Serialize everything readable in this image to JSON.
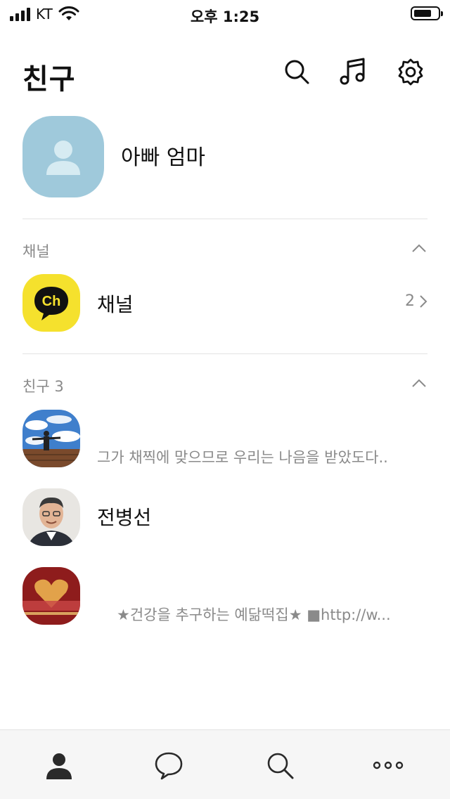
{
  "status_bar": {
    "carrier": "KT",
    "time": "오후 1:25"
  },
  "header": {
    "title": "친구",
    "icons": [
      "search-icon",
      "music-icon",
      "gear-icon"
    ]
  },
  "profile": {
    "name": "아빠 엄마"
  },
  "channel_section": {
    "label": "채널",
    "item": {
      "title": "채널",
      "count": "2",
      "badge_text": "Ch"
    }
  },
  "friends_section": {
    "label": "친구 3",
    "friends": [
      {
        "name": "",
        "status": "그가 채찍에 맞으므로 우리는 나음을 받았도다.."
      },
      {
        "name": "전병선",
        "status": ""
      },
      {
        "name": "",
        "status": "★건강을 추구하는 예닮떡집★ ■http://w..."
      }
    ]
  },
  "bottom_nav": {
    "items": [
      "friends-tab-icon",
      "chats-tab-icon",
      "search-tab-icon",
      "more-tab-icon"
    ]
  },
  "colors": {
    "accent_yellow": "#f5e12d",
    "avatar_blue": "#9fc9db",
    "muted_text": "#8a8a8a"
  }
}
